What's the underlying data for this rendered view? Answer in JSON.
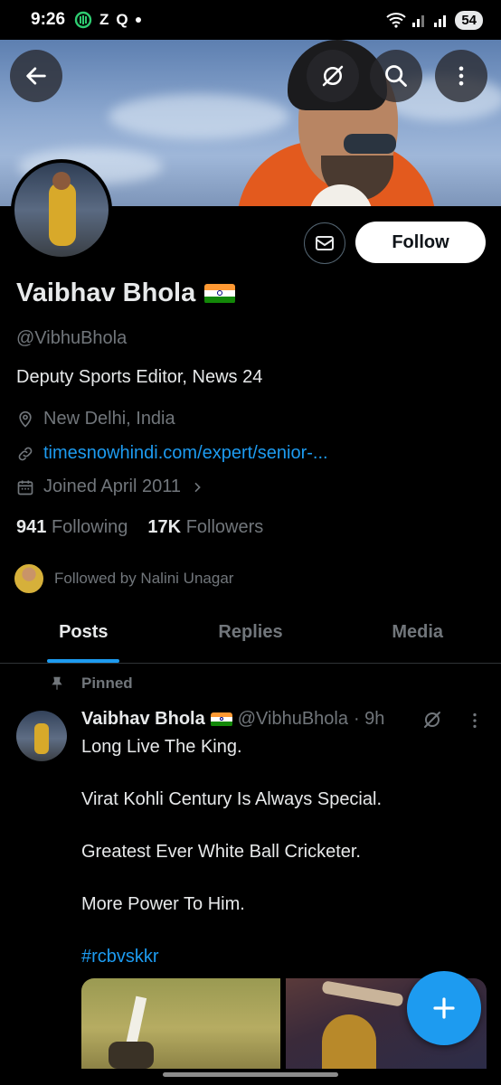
{
  "status_bar": {
    "time": "9:26",
    "left_glyphs": [
      "Z",
      "Q"
    ],
    "battery": "54"
  },
  "profile": {
    "name": "Vaibhav Bhola",
    "handle": "@VibhuBhola",
    "bio": "Deputy Sports Editor, News 24",
    "location": "New Delhi, India",
    "website": "timesnowhindi.com/expert/senior-...",
    "joined": "Joined April 2011",
    "following_count": "941",
    "following_label": "Following",
    "followers_count": "17K",
    "followers_label": "Followers",
    "followed_by": "Followed by Nalini Unagar",
    "follow_button": "Follow"
  },
  "tabs": [
    {
      "label": "Posts",
      "active": true
    },
    {
      "label": "Replies",
      "active": false
    },
    {
      "label": "Media",
      "active": false
    }
  ],
  "post": {
    "pinned_label": "Pinned",
    "author_name": "Vaibhav Bhola",
    "author_handle": "@VibhuBhola",
    "time": "· 9h",
    "lines": [
      "Long Live The King.",
      "Virat Kohli Century Is Always Special.",
      "Greatest Ever White Ball Cricketer.",
      "More Power To Him."
    ],
    "hashtag": "#rcbvskkr"
  },
  "colors": {
    "accent": "#1d9bf0",
    "background": "#000000",
    "secondary_text": "#71767b"
  },
  "icons": {
    "back": "back-arrow-icon",
    "grok": "grok-icon",
    "search": "search-icon",
    "more": "more-vertical-icon",
    "message": "mail-icon",
    "location": "location-pin-icon",
    "link": "link-icon",
    "calendar": "calendar-icon",
    "pin": "pin-icon",
    "compose": "plus-icon"
  }
}
